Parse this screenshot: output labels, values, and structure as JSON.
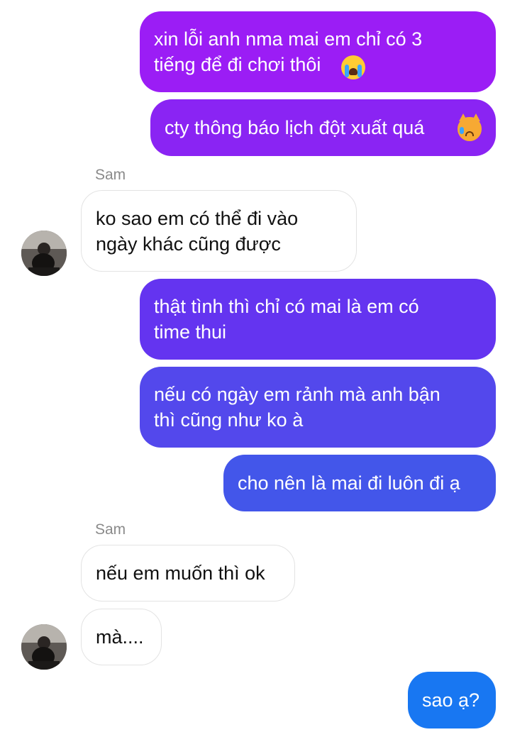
{
  "colors": {
    "outgoing_gradient": [
      "#9b1df5",
      "#7c2cf0",
      "#5a48e9",
      "#3f57e6",
      "#1877f2"
    ],
    "incoming_bg": "#ffffff",
    "incoming_border": "#e3e3e3",
    "sender_name": "#8a8a8a"
  },
  "messages": [
    {
      "id": "m1",
      "direction": "outgoing",
      "text": "xin lỗi anh nma mai em chỉ có 3\ntiếng để đi chơi thôi",
      "emoji": "loudly-crying-face-emoji"
    },
    {
      "id": "m2",
      "direction": "outgoing",
      "text": "cty thông báo lịch đột xuất quá",
      "emoji": "crying-cat-face-emoji"
    },
    {
      "id": "m3",
      "direction": "incoming",
      "sender": "Sam",
      "text": "ko sao em có thể đi vào\nngày khác cũng được"
    },
    {
      "id": "m4",
      "direction": "outgoing",
      "text": "thật tình thì chỉ có mai là em có\ntime thui"
    },
    {
      "id": "m5",
      "direction": "outgoing",
      "text": "nếu có ngày em rảnh mà anh bận\nthì cũng như ko à"
    },
    {
      "id": "m6",
      "direction": "outgoing",
      "text": "cho nên là mai đi luôn đi ạ"
    },
    {
      "id": "m7",
      "direction": "incoming",
      "sender": "Sam",
      "text": "nếu em muốn thì ok"
    },
    {
      "id": "m8",
      "direction": "incoming",
      "text": "mà...."
    },
    {
      "id": "m9",
      "direction": "outgoing",
      "text": "sao ạ?"
    }
  ]
}
